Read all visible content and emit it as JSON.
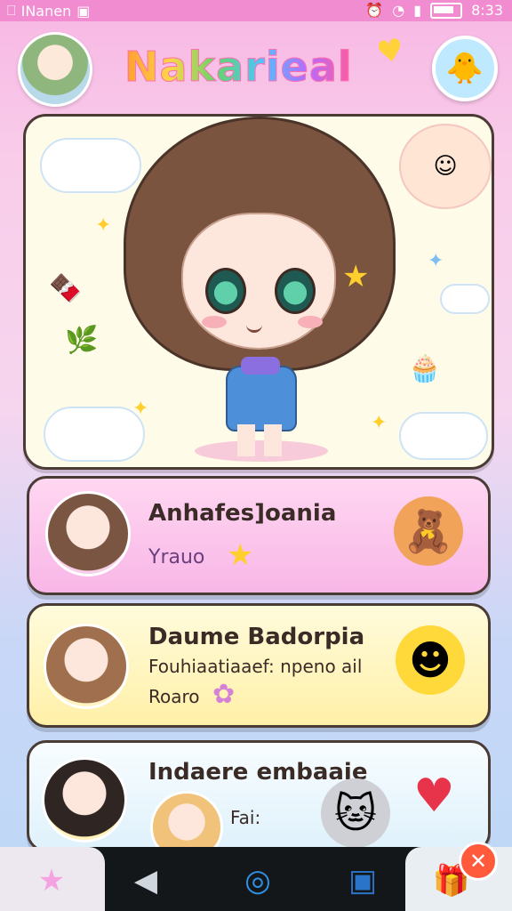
{
  "status_bar": {
    "left_text": "INanen",
    "time": "8:33"
  },
  "header": {
    "title": "Nakarieal"
  },
  "hero": {},
  "cards": [
    {
      "title": "Anhafes]oania",
      "subtitle": "Yrauo"
    },
    {
      "title": "Daume Badorpia",
      "subtitle": "Fouhiaatiaaef: npeno ail",
      "extra": "Roaro"
    },
    {
      "title": "Indaere embaaie",
      "subtitle": "Fai:"
    }
  ],
  "colors": {
    "accent_pink": "#f08ccf",
    "card1": "#f8b6e7",
    "card2": "#fff0a8",
    "card3": "#dff1fb"
  },
  "icons": [
    "q-icon",
    "image-icon",
    "alarm-icon",
    "wifi-icon",
    "signal-icon",
    "battery-icon",
    "heart-icon",
    "profile-icon",
    "star-nav-icon",
    "back-icon",
    "circle-home-icon",
    "bookmark-icon",
    "gift-icon",
    "close-icon"
  ]
}
